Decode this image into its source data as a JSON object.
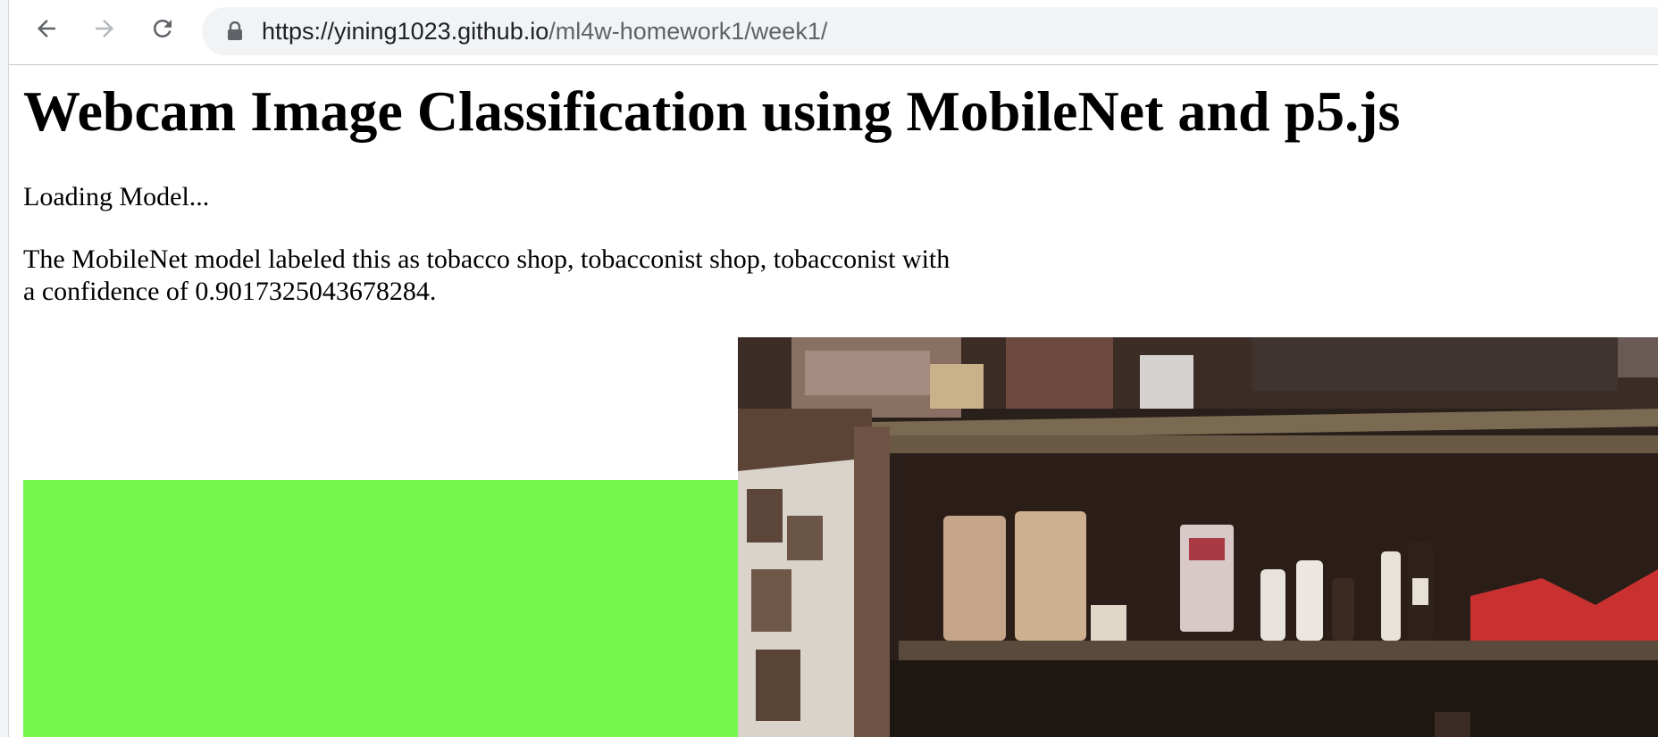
{
  "browser": {
    "url_host": "https://yining1023.github.io",
    "url_path": "/ml4w-homework1/week1/",
    "back_icon": "arrow-left-icon",
    "forward_icon": "arrow-right-icon",
    "reload_icon": "reload-icon",
    "lock_icon": "lock-icon"
  },
  "page": {
    "title": "Webcam Image Classification using MobileNet and p5.js",
    "status": "Loading Model...",
    "result": "The MobileNet model labeled this as tobacco shop, tobacconist shop, tobacconist with a confidence of 0.9017325043678284."
  },
  "canvas": {
    "color": "#77f84e"
  }
}
